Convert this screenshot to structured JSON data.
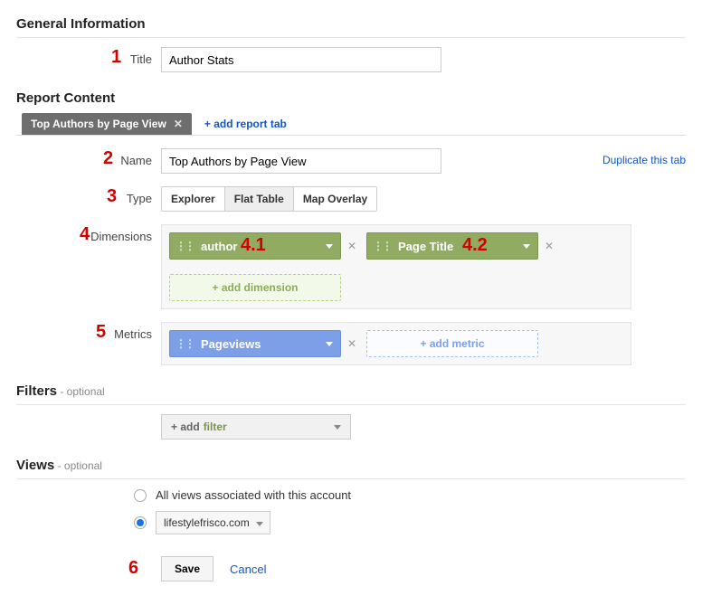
{
  "sections": {
    "general": "General Information",
    "report_content": "Report Content",
    "filters": "Filters",
    "views": "Views",
    "optional": " - optional"
  },
  "labels": {
    "title": "Title",
    "name": "Name",
    "type": "Type",
    "dimensions": "Dimensions",
    "metrics": "Metrics"
  },
  "fields": {
    "title_value": "Author Stats",
    "name_value": "Top Authors by Page View"
  },
  "tabs": {
    "active": "Top Authors by Page View",
    "add": "+ add report tab",
    "duplicate": "Duplicate this tab"
  },
  "type_options": {
    "explorer": "Explorer",
    "flat_table": "Flat Table",
    "map_overlay": "Map Overlay",
    "selected": "flat_table"
  },
  "dimensions": {
    "items": [
      {
        "label": "author"
      },
      {
        "label": "Page Title"
      }
    ],
    "add": "+ add dimension"
  },
  "metrics": {
    "items": [
      {
        "label": "Pageviews"
      }
    ],
    "add": "+ add metric"
  },
  "filters": {
    "add_prefix": "+ add ",
    "add_word": "filter"
  },
  "views": {
    "option_all": "All views associated with this account",
    "selected_view": "lifestylefrisco.com"
  },
  "actions": {
    "save": "Save",
    "cancel": "Cancel"
  },
  "annotations": {
    "n1": "1",
    "n2": "2",
    "n3": "3",
    "n4": "4",
    "n4_1": "4.1",
    "n4_2": "4.2",
    "n5": "5",
    "n6": "6"
  }
}
